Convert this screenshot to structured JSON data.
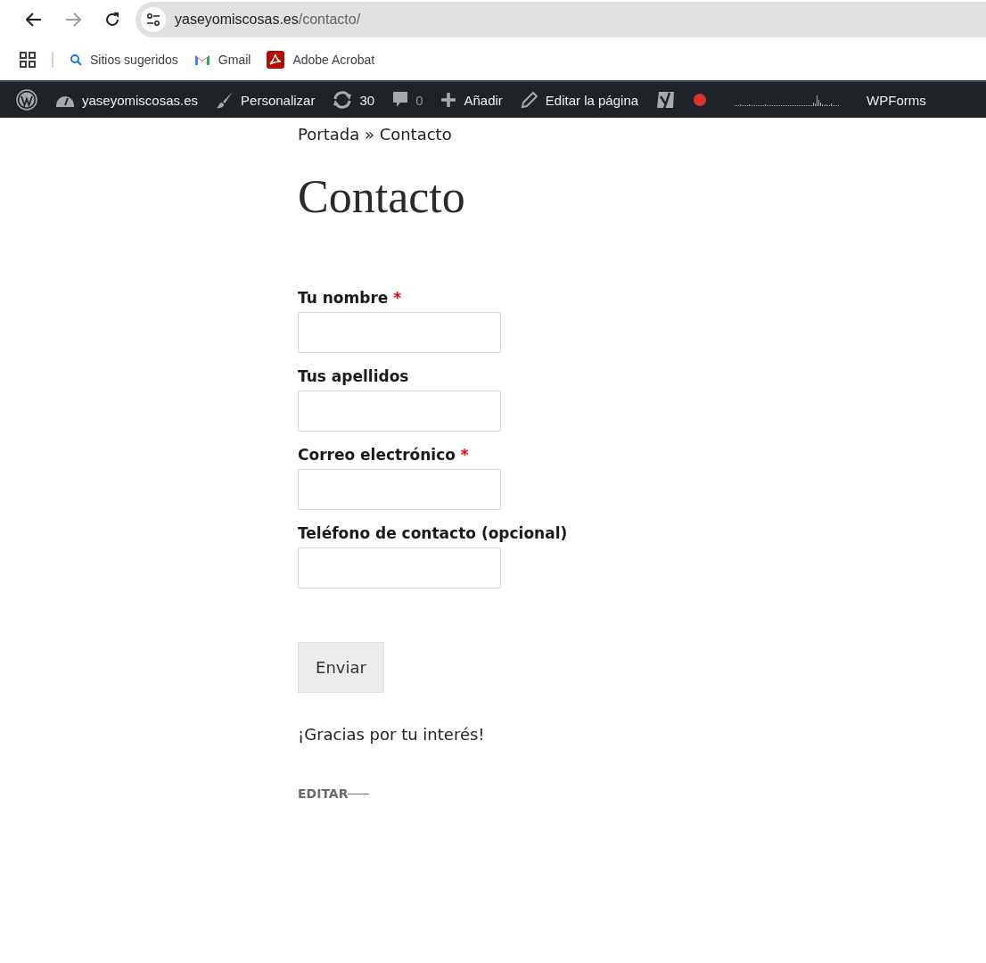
{
  "browser": {
    "url_host": "yaseyomiscosas.es",
    "url_path": "/contacto/",
    "bookmarks": [
      {
        "kind": "search",
        "label": "Sitios sugeridos"
      },
      {
        "kind": "gmail",
        "label": "Gmail"
      },
      {
        "kind": "acrobat",
        "label": "Adobe Acrobat"
      }
    ]
  },
  "admin_bar": {
    "items": [
      {
        "kind": "wp"
      },
      {
        "kind": "dashboard",
        "label": "yaseyomiscosas.es"
      },
      {
        "kind": "brush",
        "label": "Personalizar"
      },
      {
        "kind": "updates",
        "label": "30"
      },
      {
        "kind": "comments",
        "label": "0"
      },
      {
        "kind": "plus",
        "label": "Añadir"
      },
      {
        "kind": "pencil",
        "label": "Editar la página"
      },
      {
        "kind": "yoast"
      },
      {
        "kind": "stats"
      },
      {
        "kind": "text",
        "label": "WPForms"
      }
    ]
  },
  "breadcrumb": "Portada » Contacto",
  "title": "Contacto",
  "form": {
    "fields": [
      {
        "label": "Tu nombre",
        "marker": "*"
      },
      {
        "label": "Tus apellidos"
      },
      {
        "label": "Correo electrónico",
        "marker": "*"
      },
      {
        "label": "Teléfono de contacto (opcional)"
      }
    ],
    "submit": "Enviar"
  },
  "message": "¡Gracias por tu interés!",
  "edit_link": "EDITAR"
}
